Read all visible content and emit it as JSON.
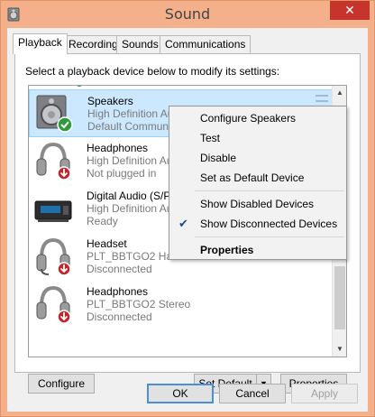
{
  "window": {
    "title": "Sound",
    "close_glyph": "✕"
  },
  "tabs": [
    {
      "label": "Playback",
      "active": true
    },
    {
      "label": "Recording"
    },
    {
      "label": "Sounds"
    },
    {
      "label": "Communications"
    }
  ],
  "instruction": "Select a playback device below to modify its settings:",
  "devices": [
    {
      "name": "Speakers",
      "line2": "High Definition Au",
      "line3": "Default Communic",
      "icon": "speaker-icon",
      "status_icon": "green-phone-check-icon",
      "selected": true
    },
    {
      "name": "Headphones",
      "line2": "High Definition Au",
      "line3": "Not plugged in",
      "icon": "headphones-icon",
      "status_icon": "red-down-arrow-icon"
    },
    {
      "name": "Digital Audio (S/PE",
      "line2": "High Definition Au",
      "line3": "Ready",
      "icon": "digital-audio-icon"
    },
    {
      "name": "Headset",
      "line2": "PLT_BBTGO2 Hands-Free",
      "line3": "Disconnected",
      "icon": "headset-icon",
      "status_icon": "red-down-arrow-icon"
    },
    {
      "name": "Headphones",
      "line2": "PLT_BBTGO2 Stereo",
      "line3": "Disconnected",
      "icon": "headphones-icon",
      "status_icon": "red-down-arrow-icon"
    }
  ],
  "context_menu": {
    "items": [
      {
        "label": "Configure Speakers"
      },
      {
        "label": "Test"
      },
      {
        "label": "Disable"
      },
      {
        "label": "Set as Default Device"
      },
      {
        "label": "Show Disabled Devices",
        "checked": false
      },
      {
        "label": "Show Disconnected Devices",
        "checked": true
      },
      {
        "label": "Properties",
        "bold": true
      }
    ],
    "check_glyph": "✔"
  },
  "panel_buttons": {
    "configure": "Configure",
    "set_default": "Set Default",
    "properties": "Properties"
  },
  "dialog_buttons": {
    "ok": "OK",
    "cancel": "Cancel",
    "apply": "Apply"
  },
  "colors": {
    "title_bar": "#f4b08a",
    "close_button": "#c7342b",
    "selection": "#cce8ff",
    "status_green": "#2e9b3a",
    "status_red": "#c0262a"
  }
}
